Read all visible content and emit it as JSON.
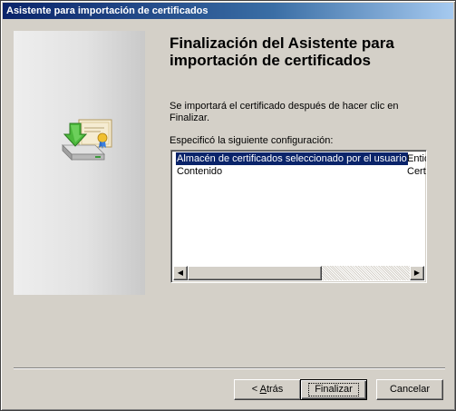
{
  "window": {
    "title": "Asistente para importación de certificados"
  },
  "content": {
    "heading": "Finalización del Asistente para importación de certificados",
    "description": "Se importará el certificado después de hacer clic en Finalizar.",
    "config_label": "Especificó la siguiente configuración:"
  },
  "settings_list": {
    "rows": [
      {
        "name": "Almacén de certificados seleccionado por el usuario",
        "value": "Entid",
        "selected": true
      },
      {
        "name": "Contenido",
        "value": "Certi",
        "selected": false
      }
    ]
  },
  "buttons": {
    "back_prefix": "< ",
    "back_accel": "A",
    "back_rest": "trás",
    "finish": "Finalizar",
    "cancel": "Cancelar"
  },
  "icons": {
    "wizard": "certificate-import-icon",
    "scroll_left": "scroll-left-arrow-icon",
    "scroll_right": "scroll-right-arrow-icon"
  },
  "colors": {
    "titlebar_start": "#0a246a",
    "titlebar_end": "#a6caf0",
    "selection": "#0a246a",
    "face": "#d4d0c8"
  }
}
